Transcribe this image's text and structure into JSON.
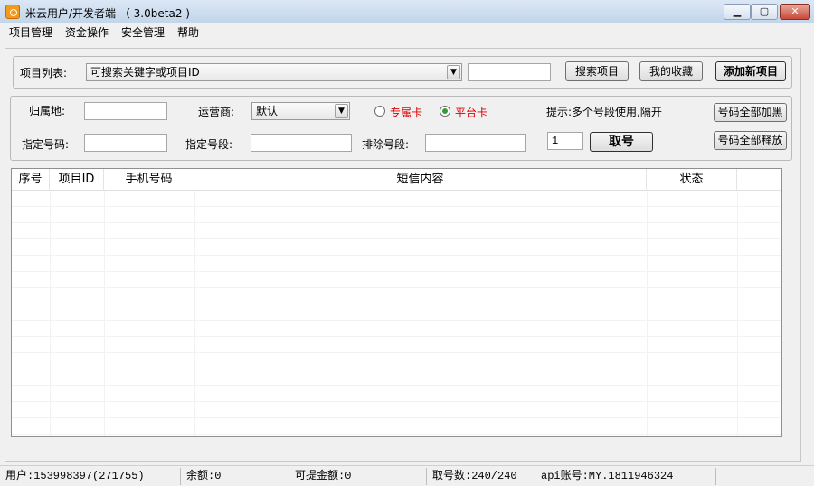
{
  "window": {
    "title": "米云用户/开发者端 （ 3.0beta2 )",
    "min_label": "▁",
    "max_label": "▢",
    "close_label": "✕"
  },
  "menu": [
    "项目管理",
    "资金操作",
    "安全管理",
    "帮助"
  ],
  "project_row": {
    "label": "项目列表:",
    "combo_value": "可搜索关键字或项目ID",
    "search_input": "",
    "search_button": "搜索项目",
    "favorites_button": "我的收藏",
    "add_button": "添加新项目"
  },
  "options": {
    "location_label": "归属地:",
    "location_value": "",
    "carrier_label": "运营商:",
    "carrier_value": "默认",
    "radio_exclusive": "专属卡",
    "radio_platform": "平台卡",
    "hint": "提示:多个号段使用,隔开",
    "blacklist_all_button": "号码全部加黑",
    "specify_number_label": "指定号码:",
    "specify_number_value": "",
    "specify_segment_label": "指定号段:",
    "specify_segment_value": "",
    "exclude_segment_label": "排除号段:",
    "exclude_segment_value": "",
    "quantity_value": "1",
    "get_number_button": "取号",
    "release_all_button": "号码全部释放"
  },
  "table": {
    "columns": [
      "序号",
      "项目ID",
      "手机号码",
      "短信内容",
      "状态"
    ],
    "rows": []
  },
  "status": {
    "user": "用户:153998397(271755)",
    "balance": "余额:0",
    "withdrawable": "可提金额:0",
    "fetched": "取号数:240/240",
    "api_account": "api账号:MY.1811946324"
  },
  "colors": {
    "radio_label": "#e00000",
    "accent_icon": "#f29a1b"
  }
}
